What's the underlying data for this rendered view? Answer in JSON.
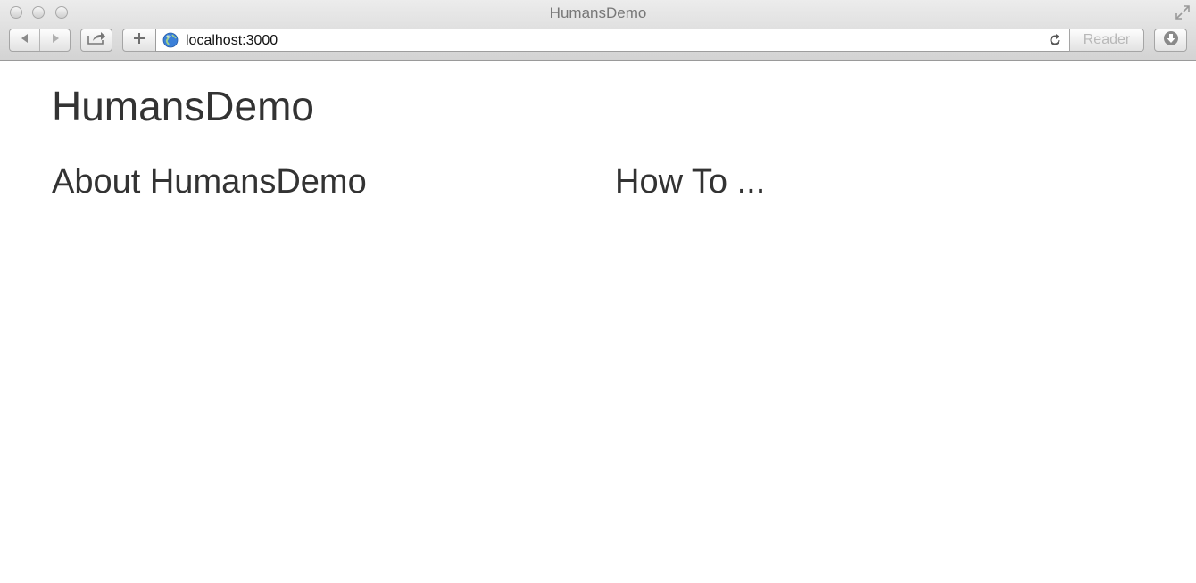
{
  "window": {
    "title": "HumansDemo"
  },
  "toolbar": {
    "url": "localhost:3000",
    "reader_label": "Reader"
  },
  "icons": {
    "back": "back-arrow-icon",
    "forward": "forward-arrow-icon",
    "share": "share-icon",
    "new_tab": "plus-icon",
    "globe": "globe-icon",
    "reload": "reload-icon",
    "download": "download-icon",
    "fullscreen": "fullscreen-icon"
  },
  "page": {
    "site_title": "HumansDemo",
    "columns": [
      {
        "heading": "About HumansDemo"
      },
      {
        "heading": "How To ..."
      }
    ]
  }
}
